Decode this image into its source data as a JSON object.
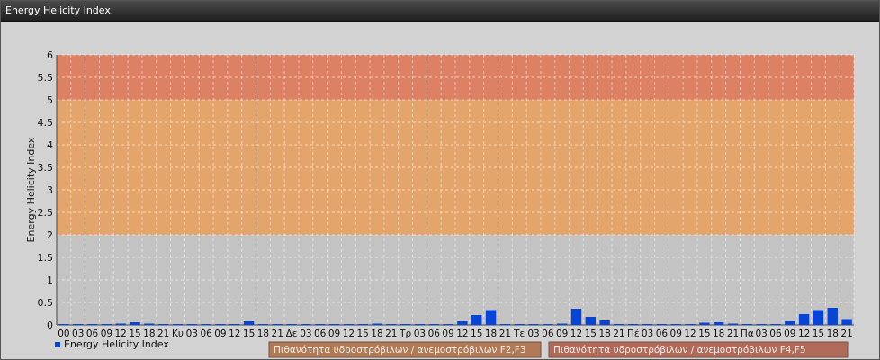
{
  "window": {
    "title": "Energy Helicity Index"
  },
  "chart_data": {
    "type": "bar",
    "ylabel": "Energy Helicity Index",
    "ylim": [
      0,
      6
    ],
    "yticks": [
      "0",
      "0.5",
      "1",
      "1.5",
      "2",
      "2.5",
      "3",
      "3.5",
      "4",
      "4.5",
      "5",
      "5.5",
      "6"
    ],
    "categories": [
      "00",
      "03",
      "06",
      "09",
      "12",
      "15",
      "18",
      "21",
      "Κυ",
      "03",
      "06",
      "09",
      "12",
      "15",
      "18",
      "21",
      "Δε",
      "03",
      "06",
      "09",
      "12",
      "15",
      "18",
      "21",
      "Τρ",
      "03",
      "06",
      "09",
      "12",
      "15",
      "18",
      "21",
      "Τε",
      "03",
      "06",
      "09",
      "12",
      "15",
      "18",
      "21",
      "Πέ",
      "03",
      "06",
      "09",
      "12",
      "15",
      "18",
      "21",
      "Πα",
      "03",
      "06",
      "09",
      "12",
      "15",
      "18",
      "21"
    ],
    "series": [
      {
        "name": "Energy Helicity Index",
        "color": "#0645d8",
        "values": [
          0.02,
          0.02,
          0.02,
          0.02,
          0.03,
          0.06,
          0.03,
          0.02,
          0.02,
          0.02,
          0.02,
          0.02,
          0.02,
          0.08,
          0.02,
          0.02,
          0.02,
          0.02,
          0.02,
          0.02,
          0.02,
          0.02,
          0.03,
          0.02,
          0.02,
          0.02,
          0.02,
          0.02,
          0.08,
          0.22,
          0.33,
          0.02,
          0.02,
          0.02,
          0.02,
          0.03,
          0.36,
          0.18,
          0.1,
          0.02,
          0.02,
          0.02,
          0.02,
          0.02,
          0.02,
          0.05,
          0.06,
          0.03,
          0.02,
          0.02,
          0.02,
          0.08,
          0.24,
          0.33,
          0.38,
          0.13
        ]
      }
    ],
    "bands": [
      {
        "from": 2,
        "to": 5,
        "color": "#e8a060",
        "label": "Πιθανότητα υδροστρόβιλων / ανεμοστρόβιλων F2,F3"
      },
      {
        "from": 5,
        "to": 6,
        "color": "#e07858",
        "label": "Πιθανότητα υδροστρόβιλων / ανεμοστρόβιλων F4,F5"
      }
    ],
    "grid": true,
    "legend": "bottom-left"
  }
}
